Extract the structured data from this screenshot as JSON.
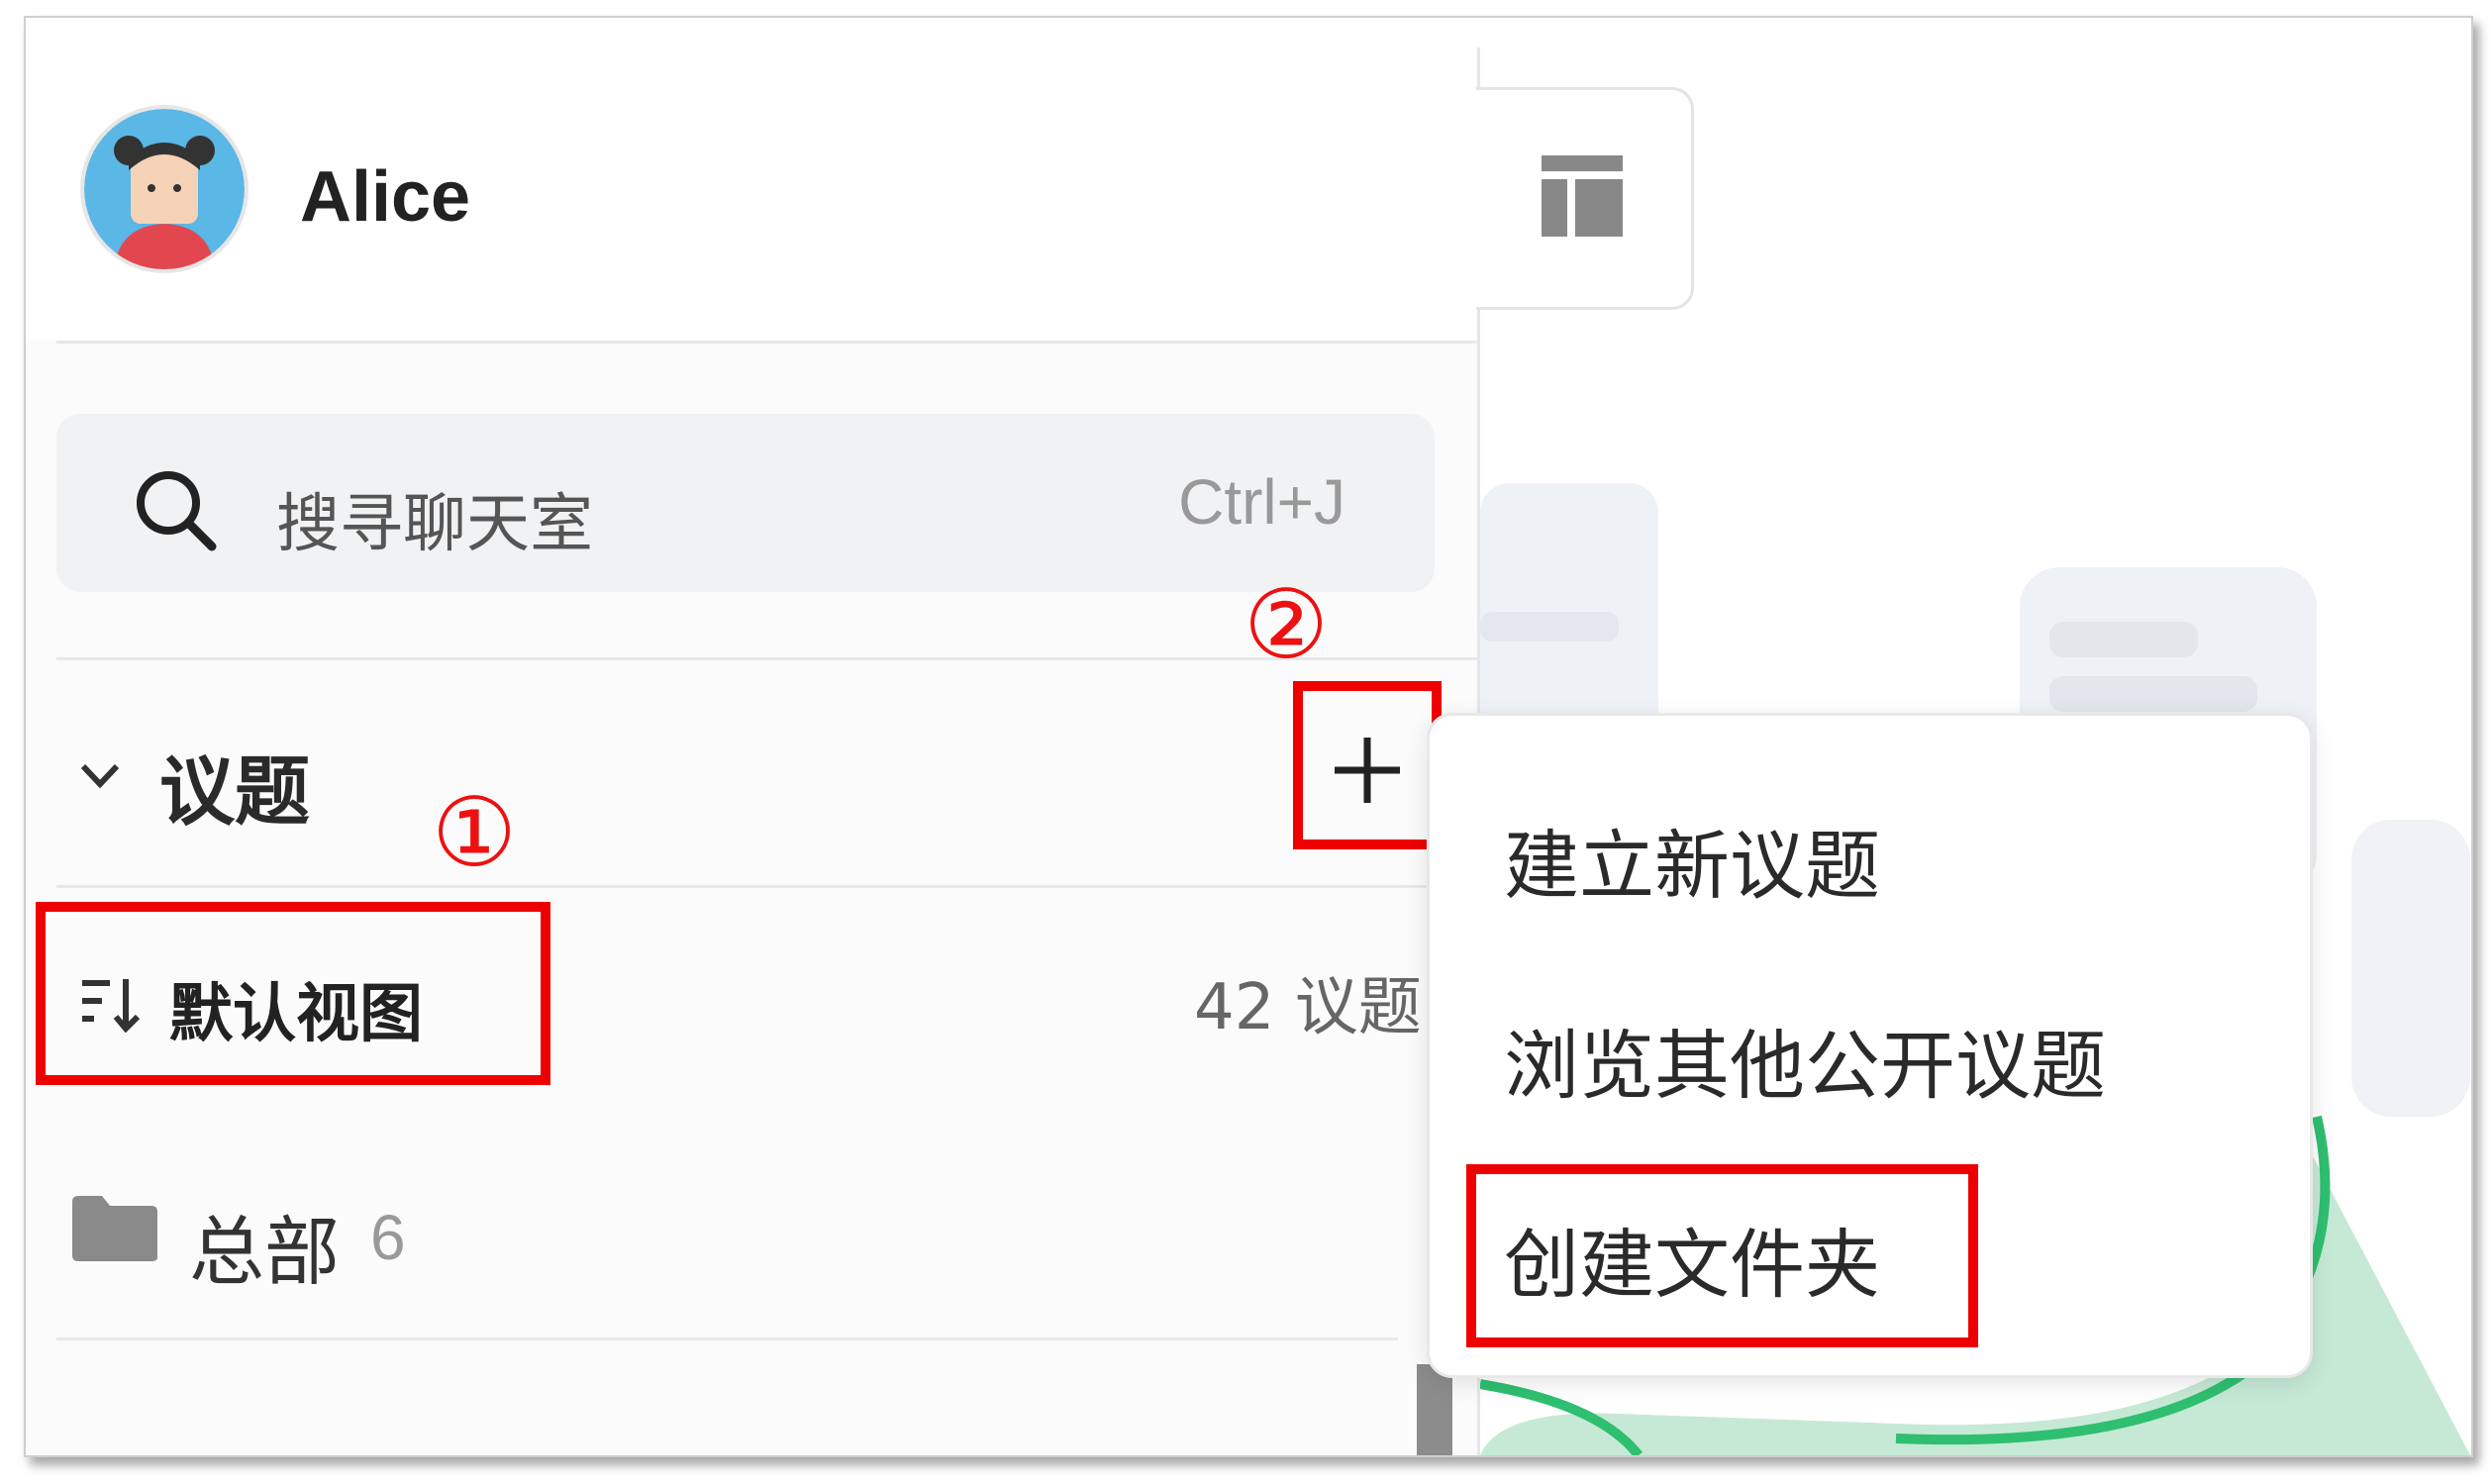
{
  "user": {
    "name": "Alice",
    "avatar_icon": "girl-avatar-icon"
  },
  "search": {
    "placeholder": "搜寻聊天室",
    "shortcut": "Ctrl+J",
    "icon": "search-icon"
  },
  "section": {
    "title": "议题",
    "collapse_icon": "chevron-down-icon",
    "add_icon": "plus-icon"
  },
  "views": [
    {
      "label": "默认视图",
      "count": "42 议题",
      "icon": "sort-list-icon"
    }
  ],
  "folders": [
    {
      "label": "总部",
      "count": "6",
      "icon": "folder-icon"
    }
  ],
  "dropdown": {
    "items": [
      {
        "label": "建立新议题"
      },
      {
        "label": "浏览其他公开议题"
      },
      {
        "label": "创建文件夹"
      }
    ]
  },
  "annotations": {
    "step1": "①",
    "step2": "②",
    "color": "#ee0000"
  },
  "toolbar": {
    "layout_icon": "layout-icon"
  }
}
